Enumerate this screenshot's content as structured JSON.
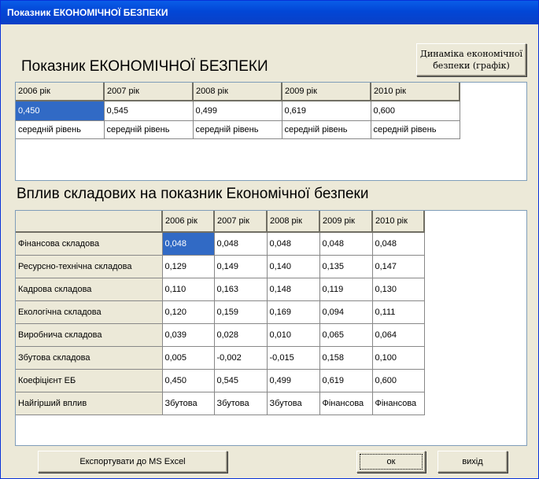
{
  "window": {
    "title": "Показник ЕКОНОМІЧНОЇ БЕЗПЕКИ"
  },
  "top": {
    "heading": "Показник ЕКОНОМІЧНОЇ БЕЗПЕКИ",
    "chart_button": "Динаміка економічної безпеки (графік)",
    "years": [
      "2006 рік",
      "2007 рік",
      "2008 рік",
      "2009 рік",
      "2010 рік"
    ],
    "values": [
      "0,450",
      "0,545",
      "0,499",
      "0,619",
      "0,600"
    ],
    "levels": [
      "середній рівень",
      "середній рівень",
      "середній рівень",
      "середній рівень",
      "середній рівень"
    ]
  },
  "bottom": {
    "heading": "Вплив складових на показник Економічної безпеки",
    "corner": "",
    "years": [
      "2006 рік",
      "2007 рік",
      "2008 рік",
      "2009 рік",
      "2010 рік"
    ],
    "rows": [
      {
        "label": "Фінансова складова",
        "values": [
          "0,048",
          "0,048",
          "0,048",
          "0,048",
          "0,048"
        ]
      },
      {
        "label": "Ресурсно-технічна складова",
        "values": [
          "0,129",
          "0,149",
          "0,140",
          "0,135",
          "0,147"
        ]
      },
      {
        "label": "Кадрова складова",
        "values": [
          "0,110",
          "0,163",
          "0,148",
          "0,119",
          "0,130"
        ]
      },
      {
        "label": "Екологічна складова",
        "values": [
          "0,120",
          "0,159",
          "0,169",
          "0,094",
          "0,111"
        ]
      },
      {
        "label": "Виробнича складова",
        "values": [
          "0,039",
          "0,028",
          "0,010",
          "0,065",
          "0,064"
        ]
      },
      {
        "label": "Збутова складова",
        "values": [
          "0,005",
          "-0,002",
          "-0,015",
          "0,158",
          "0,100"
        ]
      },
      {
        "label": "Коефіцієнт ЕБ",
        "values": [
          "0,450",
          "0,545",
          "0,499",
          "0,619",
          "0,600"
        ]
      },
      {
        "label": "Найгірший вплив",
        "values": [
          "Збутова",
          "Збутова",
          "Збутова",
          "Фінансова",
          "Фінансова"
        ]
      }
    ]
  },
  "buttons": {
    "export": "Експортувати до MS Excel",
    "ok": "ок",
    "exit": "вихід"
  }
}
